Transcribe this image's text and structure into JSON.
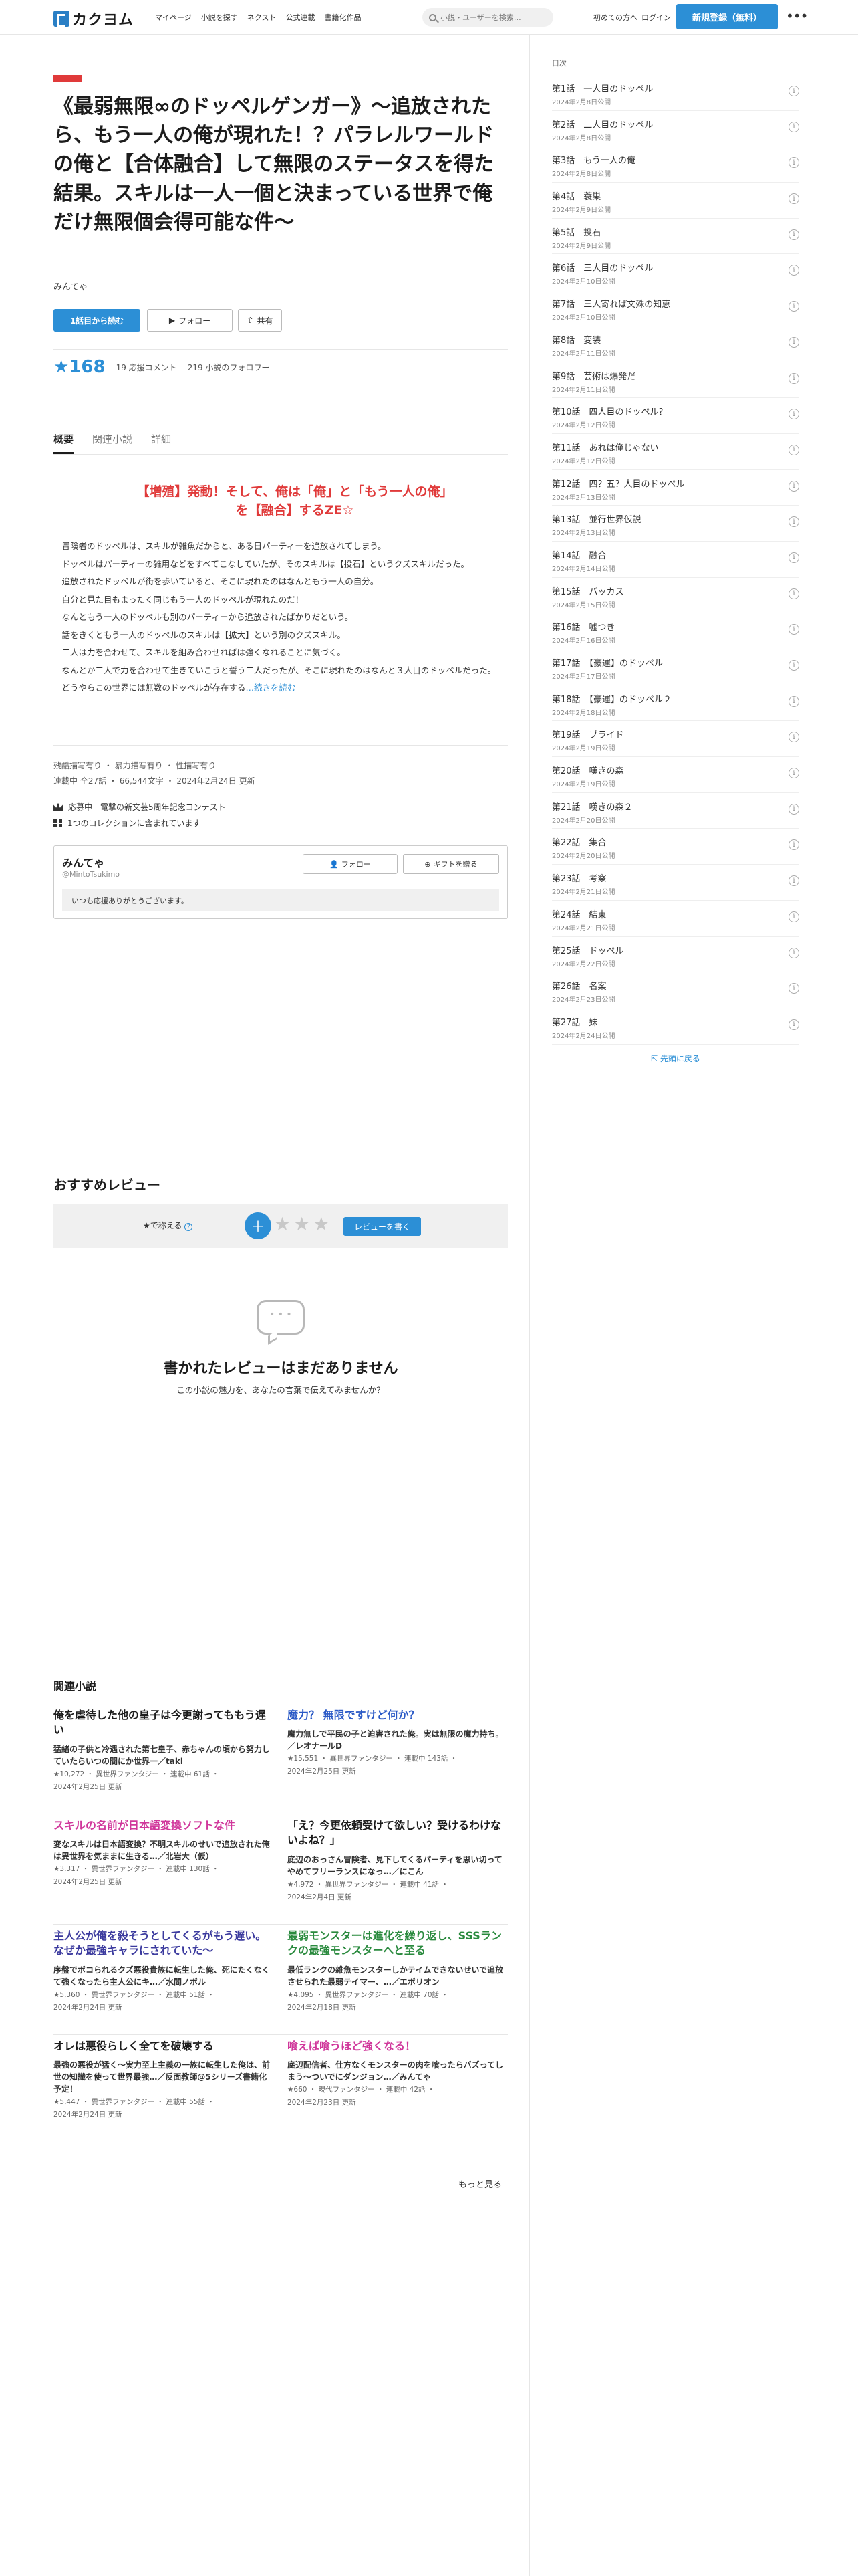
{
  "header": {
    "logo_text": "カクヨム",
    "nav": [
      "マイページ",
      "小説を探す",
      "ネクスト",
      "公式連載",
      "書籍化作品"
    ],
    "search_placeholder": "小説・ユーザーを検索…",
    "beginner": "初めての方へ",
    "login": "ログイン",
    "signup": "新規登録（無料）",
    "more": "•••"
  },
  "work": {
    "title": "《最弱無限∞のドッペルゲンガー》〜追放されたら、もう一人の俺が現れた！？パラレルワールドの俺と【合体融合】して無限のステータスを得た結果。スキルは一人一個と決まっている世界で俺だけ無限個会得可能な件〜",
    "author": "みんてゃ",
    "read_first": "1話目から読む",
    "follow": "フォロー",
    "share": "共有",
    "stars": "★168",
    "comments": "19 応援コメント",
    "followers": "219 小説のフォロワー",
    "tabs": [
      "概要",
      "関連小説",
      "詳細"
    ],
    "catchphrase": "【増殖】発動！そして、俺は「俺」と「もう一人の俺」を【融合】するZE☆",
    "intro": [
      "冒険者のドッペルは、スキルが雑魚だからと、ある日パーティーを追放されてしまう。",
      "ドッペルはパーティーの雑用などをすべてこなしていたが、そのスキルは【投石】というクズスキルだった。",
      "追放されたドッペルが街を歩いていると、そこに現れたのはなんともう一人の自分。",
      "自分と見た目もまったく同じもう一人のドッペルが現れたのだ！",
      "なんともう一人のドッペルも別のパーティーから追放されたばかりだという。",
      "話をきくともう一人のドッペルのスキルは【拡大】という別のクズスキル。",
      "二人は力を合わせて、スキルを組み合わせればは強くなれることに気づく。",
      "なんとか二人で力を合わせて生きていこうと誓う二人だったが、そこに現れたのはなんと３人目のドッペルだった。",
      "どうやらこの世界には無数のドッペルが存在する"
    ],
    "intro_more": "…続きを読む",
    "tags": "残酷描写有り ・ 暴力描写有り ・ 性描写有り",
    "status": "連載中 全27話 ・ 66,544文字 ・ 2024年2月24日 更新",
    "contest": "応募中　電撃の新文芸5周年記念コンテスト",
    "collections": "1つのコレクションに含まれています"
  },
  "author_card": {
    "name": "みんてゃ",
    "id": "@MintoTsukimo",
    "follow": "フォロー",
    "gift": "ギフトを贈る",
    "message": "いつも応援ありがとうございます。"
  },
  "toc": {
    "label": "目次",
    "back": "先頭に戻る",
    "episodes": [
      {
        "title": "第1話　一人目のドッペル",
        "date": "2024年2月8日公開"
      },
      {
        "title": "第2話　二人目のドッペル",
        "date": "2024年2月8日公開"
      },
      {
        "title": "第3話　もう一人の俺",
        "date": "2024年2月8日公開"
      },
      {
        "title": "第4話　蓑巣",
        "date": "2024年2月9日公開"
      },
      {
        "title": "第5話　投石",
        "date": "2024年2月9日公開"
      },
      {
        "title": "第6話　三人目のドッペル",
        "date": "2024年2月10日公開"
      },
      {
        "title": "第7話　三人寄れば文殊の知恵",
        "date": "2024年2月10日公開"
      },
      {
        "title": "第8話　変装",
        "date": "2024年2月11日公開"
      },
      {
        "title": "第9話　芸術は爆発だ",
        "date": "2024年2月11日公開"
      },
      {
        "title": "第10話　四人目のドッペル？",
        "date": "2024年2月12日公開"
      },
      {
        "title": "第11話　あれは俺じゃない",
        "date": "2024年2月12日公開"
      },
      {
        "title": "第12話　四？五？人目のドッペル",
        "date": "2024年2月13日公開"
      },
      {
        "title": "第13話　並行世界仮説",
        "date": "2024年2月13日公開"
      },
      {
        "title": "第14話　融合",
        "date": "2024年2月14日公開"
      },
      {
        "title": "第15話　バッカス",
        "date": "2024年2月15日公開"
      },
      {
        "title": "第16話　嘘つき",
        "date": "2024年2月16日公開"
      },
      {
        "title": "第17話　【豪運】のドッペル",
        "date": "2024年2月17日公開"
      },
      {
        "title": "第18話　【豪運】のドッペル２",
        "date": "2024年2月18日公開"
      },
      {
        "title": "第19話　ブライド",
        "date": "2024年2月19日公開"
      },
      {
        "title": "第20話　嘆きの森",
        "date": "2024年2月19日公開"
      },
      {
        "title": "第21話　嘆きの森２",
        "date": "2024年2月20日公開"
      },
      {
        "title": "第22話　集合",
        "date": "2024年2月20日公開"
      },
      {
        "title": "第23話　考察",
        "date": "2024年2月21日公開"
      },
      {
        "title": "第24話　結束",
        "date": "2024年2月21日公開"
      },
      {
        "title": "第25話　ドッペル",
        "date": "2024年2月22日公開"
      },
      {
        "title": "第26話　名案",
        "date": "2024年2月23日公開"
      },
      {
        "title": "第27話　妹",
        "date": "2024年2月24日公開"
      }
    ]
  },
  "reviews": {
    "title": "おすすめレビュー",
    "praise_label": "★で称える",
    "plus": "＋",
    "stars": "★★★",
    "write": "レビューを書く",
    "empty_title": "書かれたレビューはまだありません",
    "empty_sub": "この小説の魅力を、あなたの言葉で伝えてみませんか？"
  },
  "related": {
    "title": "関連小説",
    "more": "もっと見る",
    "items": [
      {
        "title": "俺を虐待した他の皇子は今更謝ってももう遅い",
        "color": "#1c1c1c",
        "catch": "猛緒の子供と冷遇された第七皇子、赤ちゃんの頃から努力していたらいつの間にか世界一／taki",
        "meta1": "★10,272 ・ 異世界ファンタジー ・ 連載中 61話 ・",
        "meta2": "2024年2月25日 更新"
      },
      {
        "title": "魔力？ 無限ですけど何か？",
        "color": "#2a59c6",
        "catch": "魔力無しで平民の子と迫害された俺。実は無限の魔力持ち。／レオナールD",
        "meta1": "★15,551 ・ 異世界ファンタジー ・ 連載中 143話 ・",
        "meta2": "2024年2月25日 更新"
      },
      {
        "title": "スキルの名前が日本語変換ソフトな件",
        "color": "#d0379b",
        "catch": "変なスキルは日本語変換？不明スキルのせいで追放された俺は異世界を気ままに生きる…／北岩大（仮）",
        "meta1": "★3,317 ・ 異世界ファンタジー ・ 連載中 130話 ・",
        "meta2": "2024年2月25日 更新"
      },
      {
        "title": "「え？今更依頼受けて欲しい？受けるわけないよね？」",
        "color": "#1c1c1c",
        "catch": "底辺のおっさん冒険者、見下してくるパーティを思い切ってやめてフリーランスになっ…／にこん",
        "meta1": "★4,972 ・ 異世界ファンタジー ・ 連載中 41話 ・",
        "meta2": "2024年2月4日 更新"
      },
      {
        "title": "主人公が俺を殺そうとしてくるがもう遅い。なぜか最強キャラにされていた〜",
        "color": "#3b3a9e",
        "catch": "序盤でボコられるクズ悪役貴族に転生した俺、死にたくなくて強くなったら主人公にキ…／水間ノボル",
        "meta1": "★5,360 ・ 異世界ファンタジー ・ 連載中 51話 ・",
        "meta2": "2024年2月24日 更新"
      },
      {
        "title": "最弱モンスターは進化を繰り返し、SSSランクの最強モンスターへと至る",
        "color": "#2a8a3e",
        "catch": "最低ランクの雑魚モンスターしかテイムできないせいで追放させられた最弱テイマー、…／エボリオン",
        "meta1": "★4,095 ・ 異世界ファンタジー ・ 連載中 70話 ・",
        "meta2": "2024年2月18日 更新"
      },
      {
        "title": "オレは悪役らしく全てを破壊する",
        "color": "#1c1c1c",
        "catch": "最強の悪役が猛く〜実力至上主義の一族に転生した俺は、前世の知識を使って世界最強…／反面教師@5シリーズ書籍化予定！",
        "meta1": "★5,447 ・ 異世界ファンタジー ・ 連載中 55話 ・",
        "meta2": "2024年2月24日 更新"
      },
      {
        "title": "喰えば喰うほど強くなる！",
        "color": "#d0379b",
        "catch": "底辺配信者、仕方なくモンスターの肉を喰ったらバズってしまう〜ついでにダンジョン…／みんてゃ",
        "meta1": "★660 ・ 現代ファンタジー ・ 連載中 42話 ・",
        "meta2": "2024年2月23日 更新"
      }
    ]
  }
}
